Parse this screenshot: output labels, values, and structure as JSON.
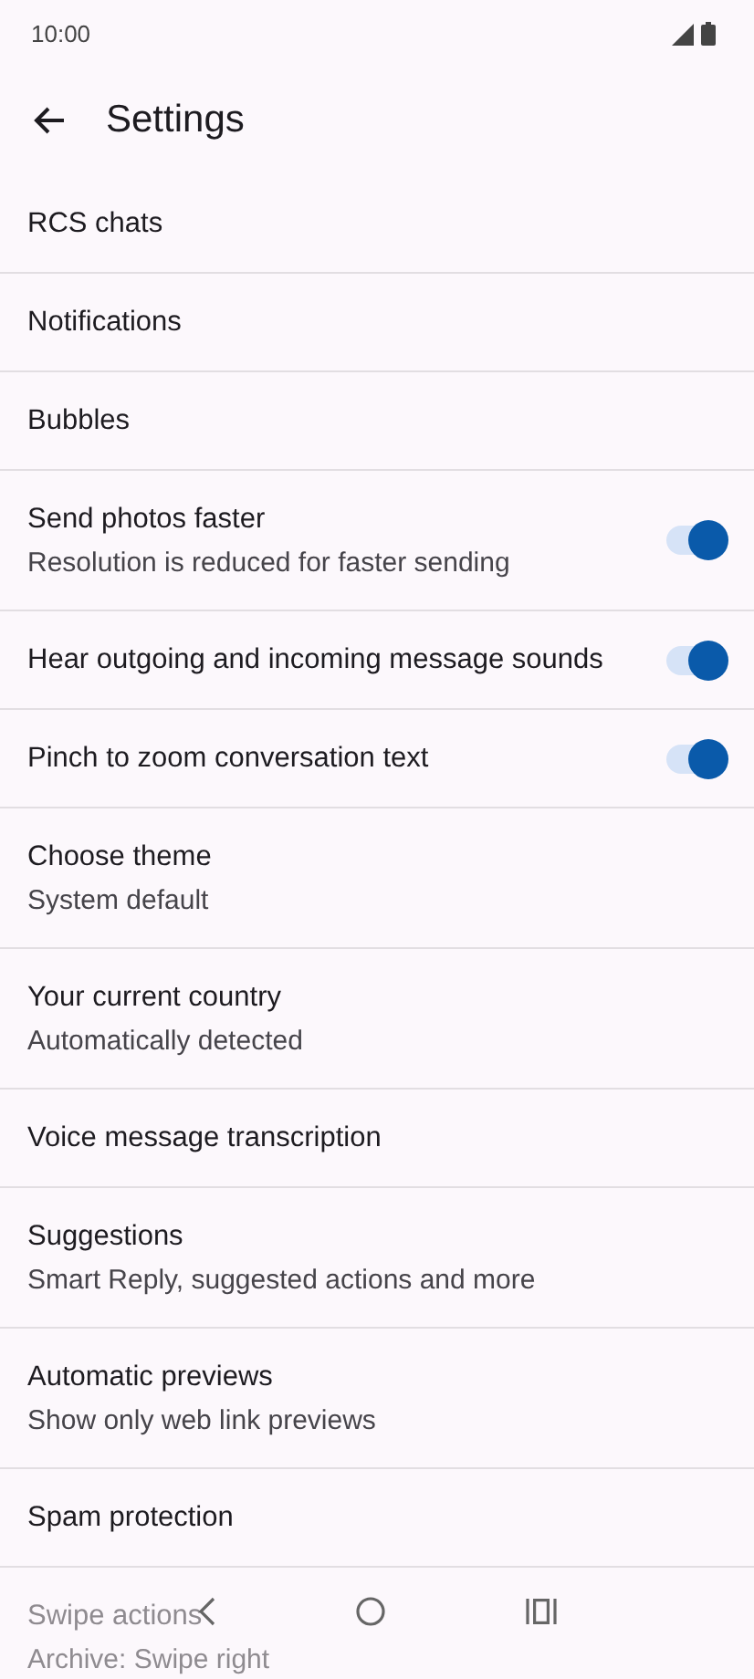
{
  "status_bar": {
    "time": "10:00"
  },
  "app_bar": {
    "title": "Settings"
  },
  "items": [
    {
      "kind": "plain",
      "title": "RCS chats"
    },
    {
      "kind": "plain",
      "title": "Notifications"
    },
    {
      "kind": "plain",
      "title": "Bubbles"
    },
    {
      "kind": "toggle",
      "title": "Send photos faster",
      "subtitle": "Resolution is reduced for faster sending",
      "on": true
    },
    {
      "kind": "toggle",
      "title": "Hear outgoing and incoming message sounds",
      "on": true
    },
    {
      "kind": "toggle",
      "title": "Pinch to zoom conversation text",
      "on": true
    },
    {
      "kind": "plain",
      "title": "Choose theme",
      "subtitle": "System default"
    },
    {
      "kind": "plain",
      "title": "Your current country",
      "subtitle": "Automatically detected"
    },
    {
      "kind": "plain",
      "title": "Voice message transcription"
    },
    {
      "kind": "plain",
      "title": "Suggestions",
      "subtitle": "Smart Reply, suggested actions and more"
    },
    {
      "kind": "plain",
      "title": "Automatic previews",
      "subtitle": "Show only web link previews"
    },
    {
      "kind": "plain",
      "title": "Spam protection"
    },
    {
      "kind": "plain",
      "title": "Swipe actions",
      "subtitle": "Archive: Swipe right"
    }
  ]
}
